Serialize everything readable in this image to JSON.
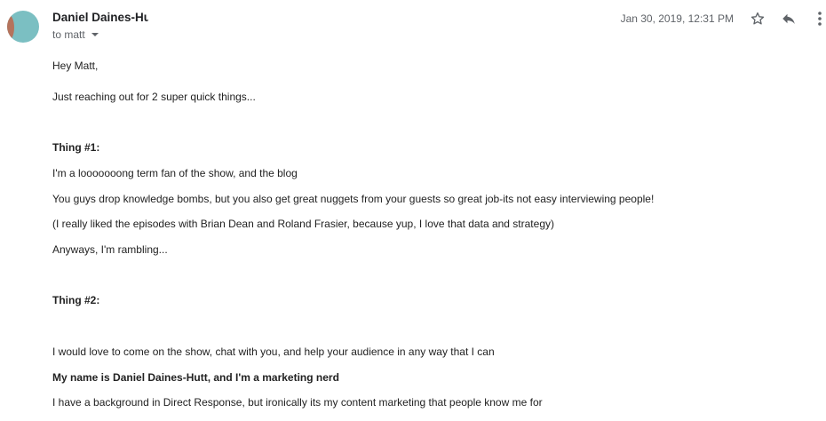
{
  "header": {
    "sender_name": "Daniel Daines-Hutt",
    "recipient": "to matt",
    "date": "Jan 30, 2019, 12:31 PM",
    "icons": {
      "star": "star-icon",
      "reply": "reply-icon",
      "more": "more-vert-icon"
    },
    "colors": {
      "avatar_bg": "#7bbfc2",
      "secondary_text": "#5f6368"
    }
  },
  "message": {
    "greeting": "Hey Matt,",
    "intro": "Just reaching out for 2 super quick things...",
    "thing1_heading": "Thing #1:",
    "thing1_line1": "I'm a looooooong term fan of the show, and the blog",
    "thing1_line2": "You guys drop knowledge bombs, but you also get great nuggets from your guests so great job-its not easy interviewing people!",
    "thing1_line3": "(I really liked the episodes with Brian Dean and Roland Frasier, because yup, I love that data and strategy)",
    "thing1_line4": "Anyways, I'm rambling...",
    "thing2_heading": "Thing #2:",
    "thing2_line1": "I would love to come on the show, chat with you, and help your audience in any way that I can",
    "thing2_line2": "My name is Daniel Daines-Hutt, and I'm a marketing nerd",
    "thing2_line3": "I have a background in Direct Response, but ironically its my content marketing that people know me for"
  }
}
